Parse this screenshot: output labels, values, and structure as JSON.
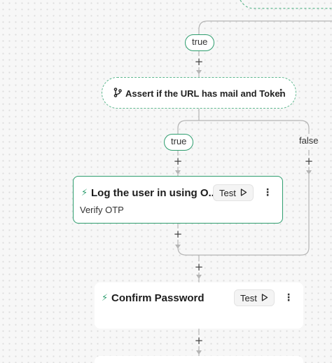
{
  "flow": {
    "branch_true_1": "true",
    "condition": {
      "label": "Assert if the URL has mail and Token"
    },
    "branch_true_2": "true",
    "branch_false": "false",
    "step_login": {
      "title": "Log the user in using O...",
      "subtitle": "Verify OTP",
      "test_label": "Test"
    },
    "step_confirm": {
      "title": "Confirm Password",
      "test_label": "Test"
    },
    "plus": "+"
  },
  "colors": {
    "accent": "#2f9e6f",
    "connector": "#b5b5b5"
  },
  "icons": [
    "lightning-icon",
    "branch-icon",
    "play-icon",
    "more-vertical-icon",
    "plus-icon"
  ]
}
